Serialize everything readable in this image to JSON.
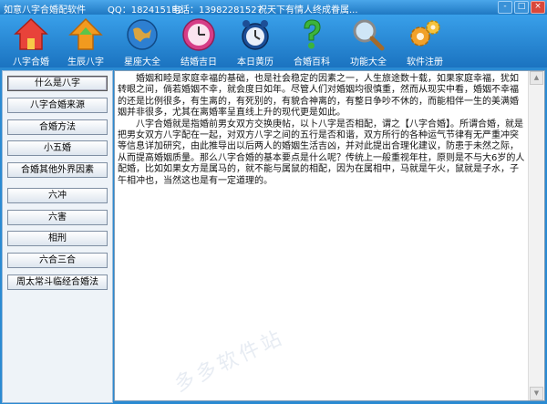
{
  "window": {
    "title": "如意八字合婚配软件",
    "qq": "QQ：182415132",
    "tel": "电话：13982281527",
    "slogan": "祝天下有情人终成眷属...",
    "buttons": [
      "-",
      "□",
      "×"
    ]
  },
  "toolbar": {
    "items": [
      {
        "label": "八字合婚",
        "icon": "house-icon"
      },
      {
        "label": "生辰八字",
        "icon": "arrow-up-house-icon"
      },
      {
        "label": "星座大全",
        "icon": "globe-icon"
      },
      {
        "label": "结婚吉日",
        "icon": "clock-icon"
      },
      {
        "label": "本日黄历",
        "icon": "alarm-clock-icon"
      },
      {
        "label": "合婚百科",
        "icon": "question-icon"
      },
      {
        "label": "功能大全",
        "icon": "magnifier-icon"
      },
      {
        "label": "软件注册",
        "icon": "gears-icon"
      }
    ]
  },
  "sidebar": {
    "items": [
      "什么是八字",
      "八字合婚来源",
      "合婚方法",
      "小五婚",
      "合婚其他外界因素",
      "六冲",
      "六害",
      "相刑",
      "六合三合",
      "周太常斗临经合婚法"
    ]
  },
  "content": {
    "paragraphs": [
      "　　婚姻和睦是家庭幸福的基础，也是社会稳定的因素之一，人生旅途数十载，如果家庭幸福，犹如转眼之间，倘若婚姻不幸，就会度日如年。尽管人们对婚姻均很慎重，然而从现实中看，婚姻不幸福的还是比例很多，有生离的，有死别的，有貌合神离的，有整日争吵不休的，而能相伴一生的美满婚姻并非很多，尤其在离婚率呈直线上升的现代更是如此。",
      "　　八字合婚就是指婚前男女双方交换庚帖，以卜八字是否相配，谓之【八字合婚】。所谓合婚，就是把男女双方八字配在一起，对双方八字之间的五行是否和谐，双方所行的各种运气节律有无严重冲突等信息详加研究，由此推导出以后两人的婚姻生活吉凶，并对此提出合理化建议，防患于未然之际，从而提高婚姻质量。那么八字合婚的基本要点是什么呢？传统上一般重视年柱，原则是不与大6岁的人配婚，比如如果女方是属马的，就不能与属鼠的相配，因为在属相中，马就是午火，鼠就是子水，子午相冲也，当然这也是有一定道理的。"
    ]
  },
  "watermark": "多多软件站",
  "colors": {
    "window_bg": "#2a8ad2",
    "content_bg": "#ffffff",
    "button_border": "#7f8fa3"
  }
}
